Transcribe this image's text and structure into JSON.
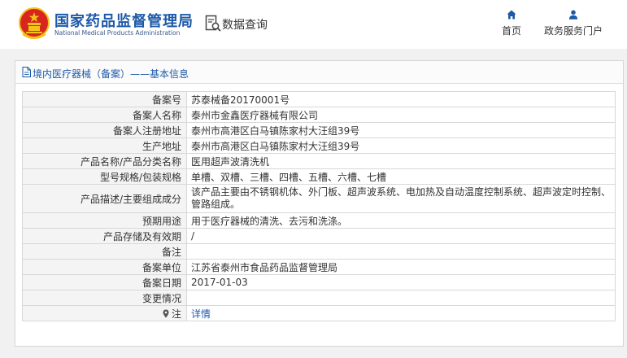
{
  "header": {
    "brand_cn": "国家药品监督管理局",
    "brand_en": "National Medical Products Administration",
    "query_label": "数据查询",
    "nav": {
      "home": "首页",
      "gov_portal": "政务服务门户"
    }
  },
  "panel": {
    "title": "境内医疗器械（备案）——基本信息"
  },
  "record": {
    "rows": [
      {
        "label": "备案号",
        "value": "苏泰械备20170001号"
      },
      {
        "label": "备案人名称",
        "value": "泰州市金鑫医疗器械有限公司"
      },
      {
        "label": "备案人注册地址",
        "value": "泰州市高港区白马镇陈家村大汪组39号"
      },
      {
        "label": "生产地址",
        "value": "泰州市高港区白马镇陈家村大汪组39号"
      },
      {
        "label": "产品名称/产品分类名称",
        "value": "医用超声波清洗机"
      },
      {
        "label": "型号规格/包装规格",
        "value": "单槽、双槽、三槽、四槽、五槽、六槽、七槽"
      },
      {
        "label": "产品描述/主要组成成分",
        "value": "该产品主要由不锈钢机体、外门板、超声波系统、电加热及自动温度控制系统、超声波定时控制、管路组成。"
      },
      {
        "label": "预期用途",
        "value": "用于医疗器械的清洗、去污和洗涤。"
      },
      {
        "label": "产品存储及有效期",
        "value": "/"
      },
      {
        "label": "备注",
        "value": ""
      },
      {
        "label": "备案单位",
        "value": "江苏省泰州市食品药品监督管理局"
      },
      {
        "label": "备案日期",
        "value": "2017-01-03"
      },
      {
        "label": "变更情况",
        "value": ""
      },
      {
        "label": "注",
        "value": "详情"
      }
    ]
  },
  "colors": {
    "brand_blue": "#1d5aa8",
    "emblem_red": "#d7261e",
    "emblem_gold": "#f5c21b",
    "label_bg": "#f4f4f4"
  },
  "icons": {
    "emblem": "national-emblem",
    "query": "magnifier-document-icon",
    "home": "home-icon",
    "gov": "user-icon",
    "doc": "document-icon",
    "pin": "location-pin-icon"
  }
}
